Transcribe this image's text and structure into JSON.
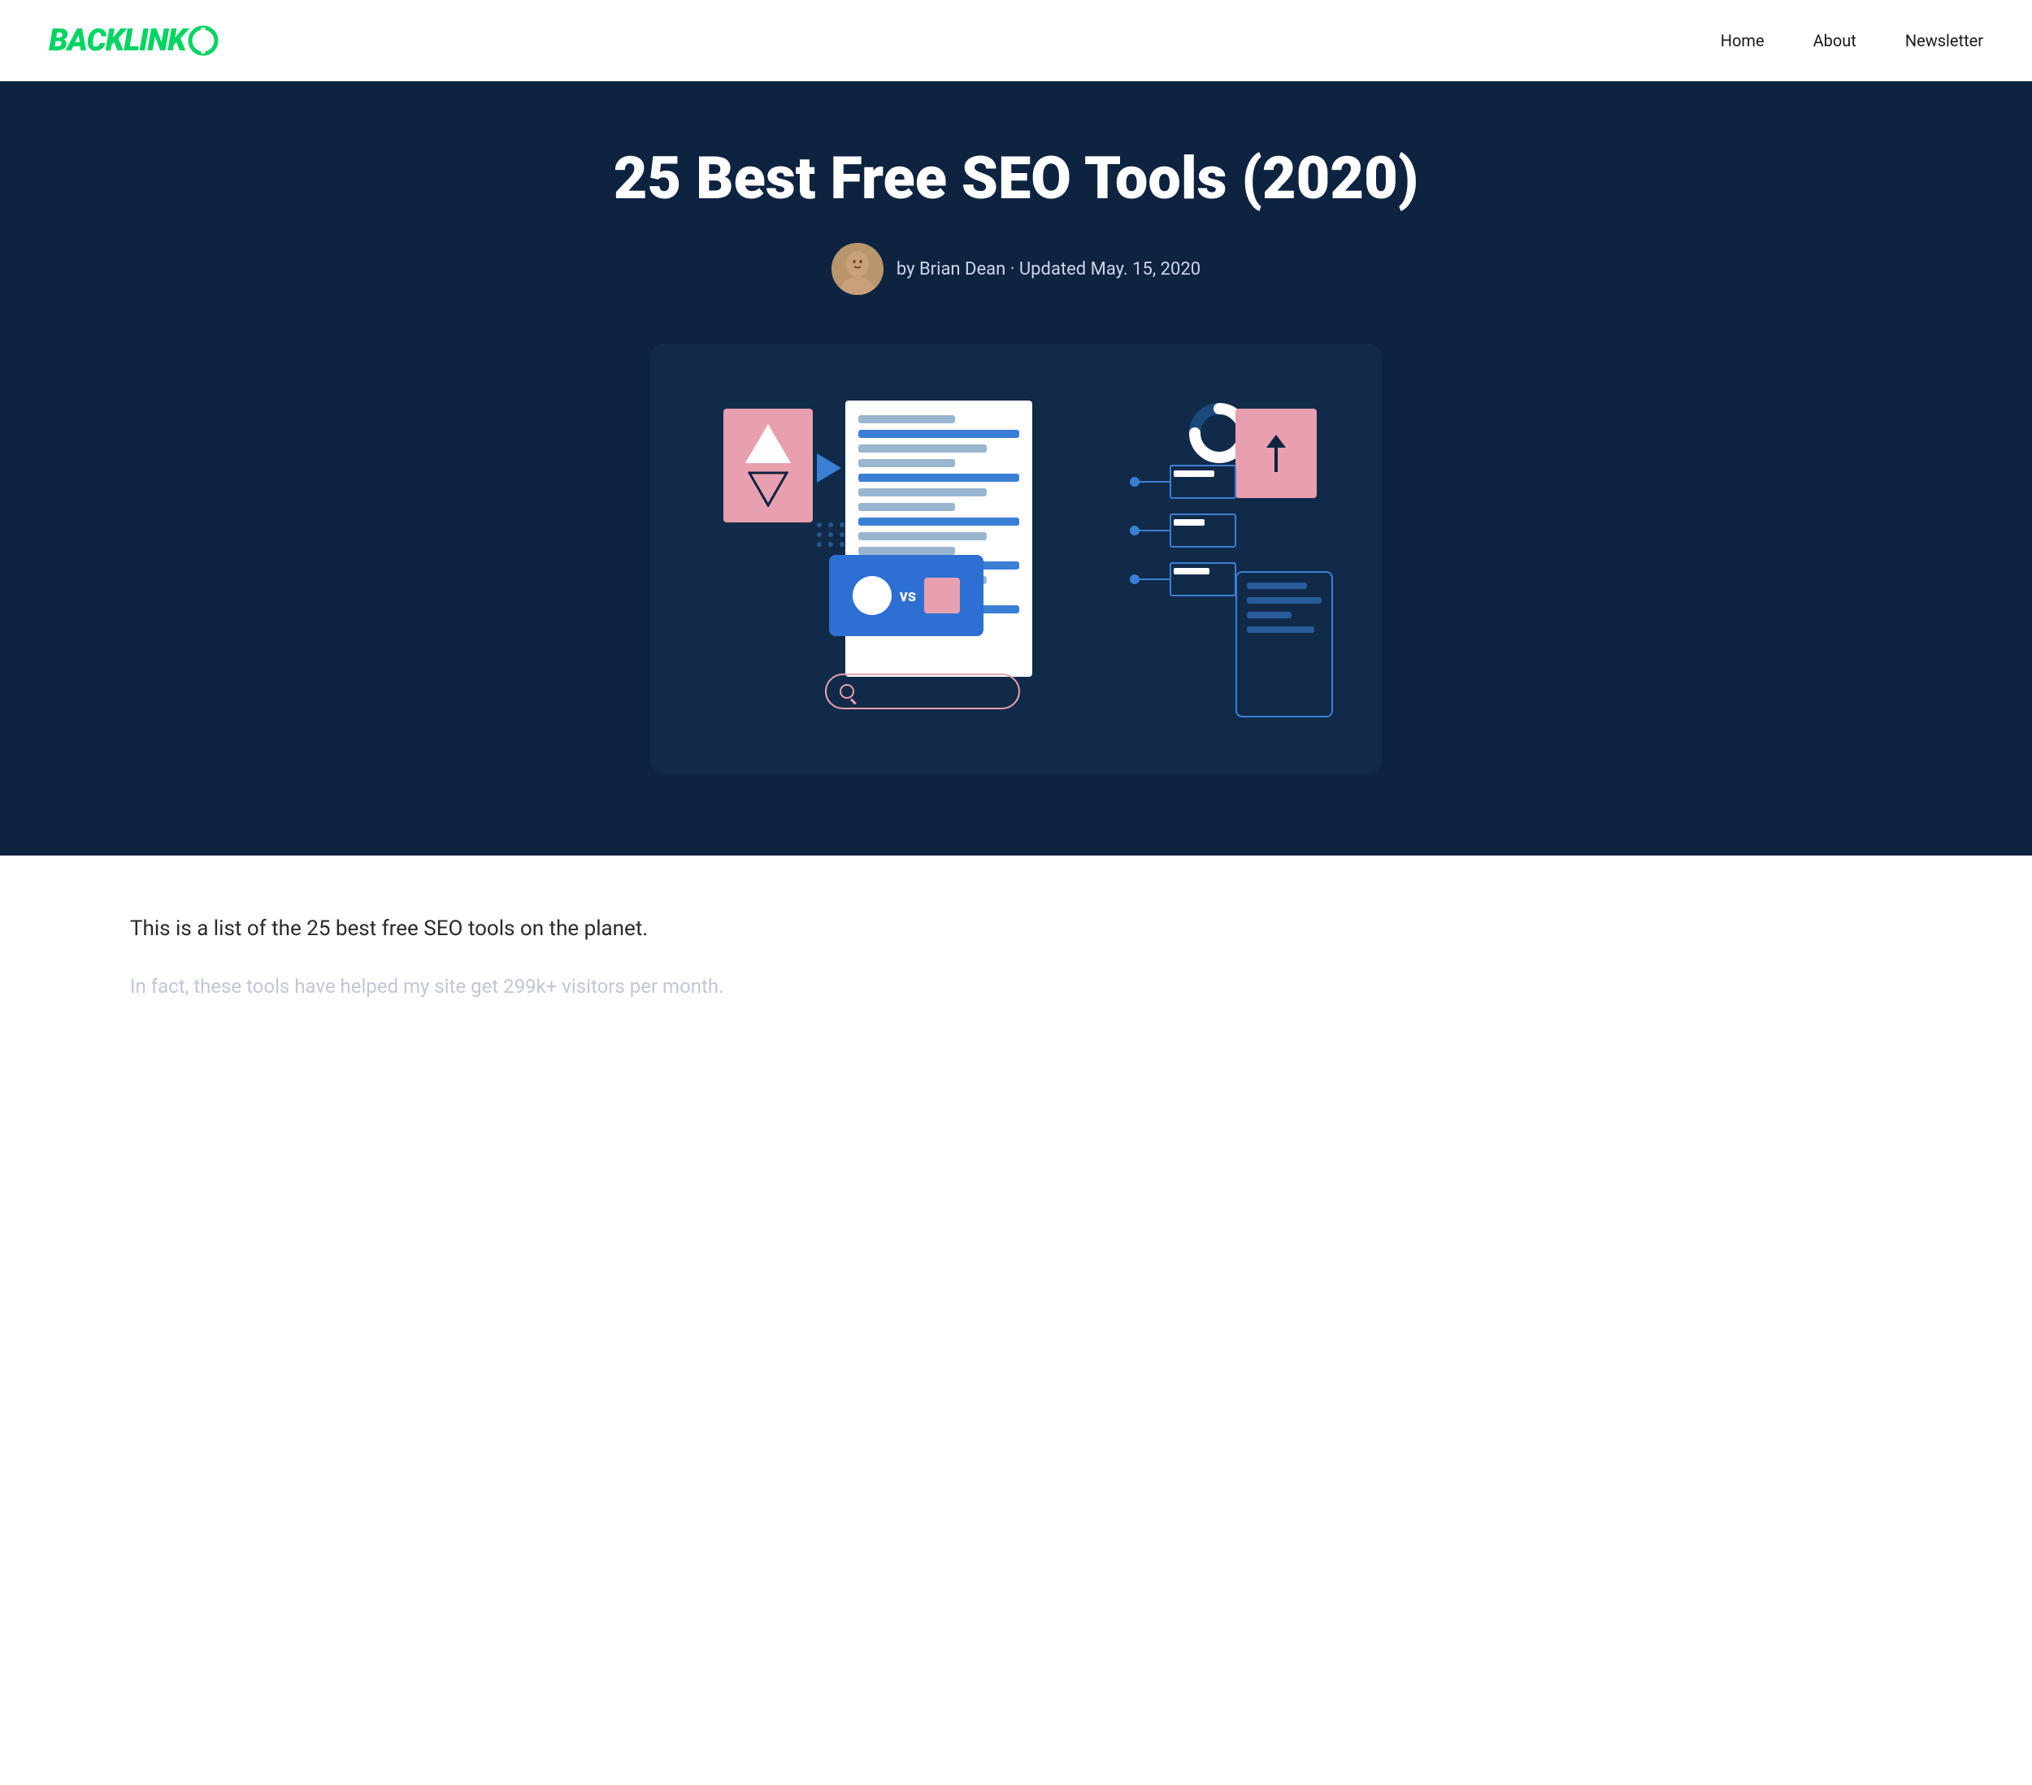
{
  "header": {
    "logo_text": "BACKLINKO",
    "nav": {
      "home": "Home",
      "about": "About",
      "newsletter": "Newsletter"
    }
  },
  "hero": {
    "title": "25 Best Free SEO Tools (2020)",
    "byline": "by Brian Dean · Updated May. 15, 2020"
  },
  "content": {
    "lead": "This is a list of the 25 best free SEO tools on the planet.",
    "secondary": "In fact, these tools have helped my site get 299k+ visitors per month."
  }
}
